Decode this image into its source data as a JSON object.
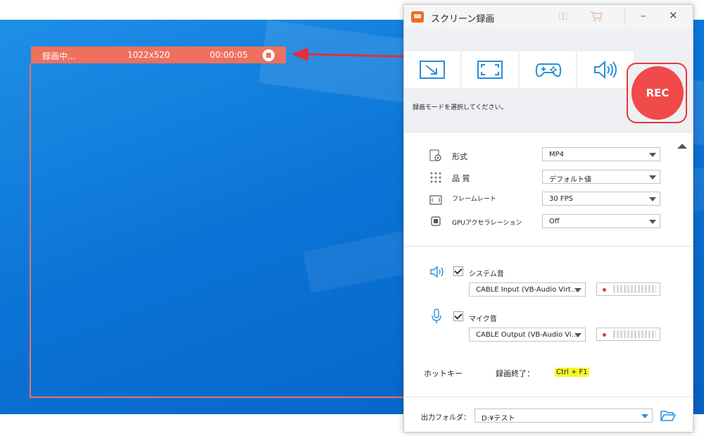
{
  "overlay": {
    "status": "録画中...",
    "resolution": "1022x520",
    "elapsed": "00:00:05",
    "stop_icon": "stop-circle-icon",
    "accent_color": "#f0705e"
  },
  "window": {
    "title": "スクリーン録画",
    "icons": [
      "app-logo-icon",
      "key-icon",
      "cart-icon",
      "minimize-icon",
      "close-icon"
    ],
    "minimize_glyph": "–",
    "close_glyph": "✕"
  },
  "modes": {
    "items": [
      "region-capture-icon",
      "fullscreen-icon",
      "game-controller-icon",
      "audio-only-icon"
    ],
    "hint": "録画モードを選択してください。"
  },
  "rec_button": {
    "label": "REC",
    "color": "#f04a4a"
  },
  "settings": {
    "format": {
      "label": "形式",
      "value": "MP4"
    },
    "quality": {
      "label": "品 質",
      "value": "デフォルト値"
    },
    "framerate": {
      "label": "フレームレート",
      "value": "30 FPS"
    },
    "gpu": {
      "label": "GPUアクセラレーション",
      "value": "Off"
    }
  },
  "audio": {
    "system": {
      "label": "システム音",
      "checked": true,
      "device": "CABLE Input (VB-Audio Virt..."
    },
    "mic": {
      "label": "マイク音",
      "checked": true,
      "device": "CABLE Output (VB-Audio Vi..."
    }
  },
  "hotkey": {
    "label": "ホットキー",
    "stop_label": "録画終了：",
    "stop_key": "Ctrl + F1"
  },
  "output": {
    "label": "出力フォルダ：",
    "path": "D:¥テスト"
  }
}
